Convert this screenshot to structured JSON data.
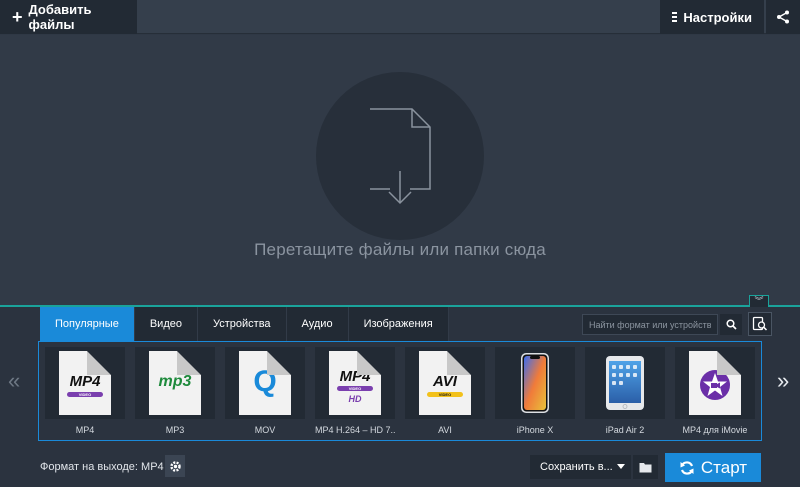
{
  "toolbar": {
    "add_files_label": "Добавить файлы",
    "settings_label": "Настройки"
  },
  "drop": {
    "hint": "Перетащите файлы или папки сюда"
  },
  "tabs": [
    {
      "label": "Популярные",
      "active": true
    },
    {
      "label": "Видео",
      "active": false
    },
    {
      "label": "Устройства",
      "active": false
    },
    {
      "label": "Аудио",
      "active": false
    },
    {
      "label": "Изображения",
      "active": false
    }
  ],
  "search": {
    "placeholder": "Найти формат или устройство..."
  },
  "formats": [
    {
      "label": "MP4",
      "badge": "MP4",
      "sub": "VIDEO"
    },
    {
      "label": "MP3",
      "badge": "mp3"
    },
    {
      "label": "MOV",
      "badge": "Q"
    },
    {
      "label": "MP4 H.264 – HD 7...",
      "badge": "MP4",
      "sub": "VIDEO",
      "extra": "HD"
    },
    {
      "label": "AVI",
      "badge": "AVI",
      "sub": "VIDEO"
    },
    {
      "label": "iPhone X"
    },
    {
      "label": "iPad Air 2"
    },
    {
      "label": "MP4 для iMovie"
    }
  ],
  "footer": {
    "output_format_label": "Формат на выходе: MP4",
    "save_label": "Сохранить в...",
    "start_label": "Старт"
  },
  "colors": {
    "accent": "#1a8ad9",
    "divider": "#1aa39b"
  }
}
